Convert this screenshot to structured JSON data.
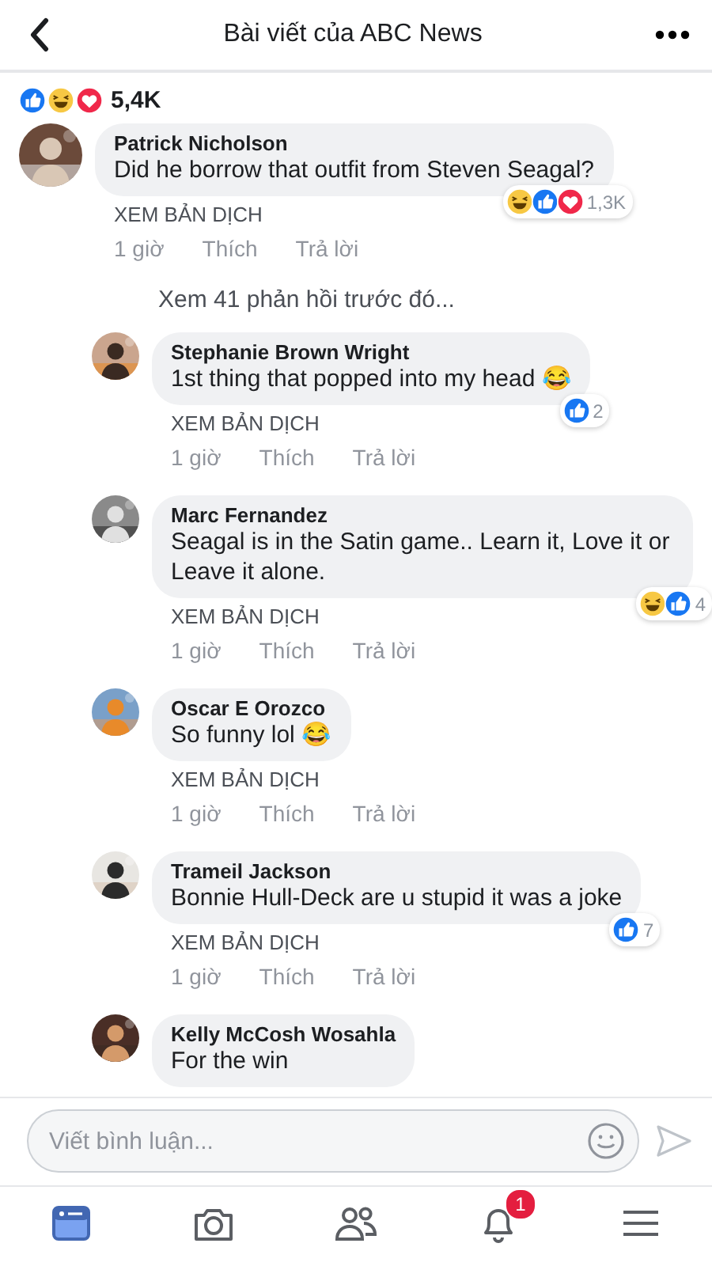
{
  "header": {
    "title": "Bài viết của ABC News"
  },
  "post_reactions": {
    "icons": [
      {
        "kind": "like"
      },
      {
        "kind": "haha"
      },
      {
        "kind": "love"
      }
    ],
    "count": "5,4K"
  },
  "comments": [
    {
      "author": "Patrick Nicholson",
      "text": "Did he borrow that outfit from Steven Seagal?",
      "translate": "XEM BẢN DỊCH",
      "time": "1 giờ",
      "like": "Thích",
      "reply": "Trả lời",
      "reactions": {
        "icons": [
          {
            "kind": "haha"
          },
          {
            "kind": "like"
          },
          {
            "kind": "love"
          }
        ],
        "count": "1,3K"
      },
      "previous_replies": "Xem 41 phản hồi trước đó...",
      "children": [
        {
          "author": "Stephanie Brown Wright",
          "text": "1st thing that popped into my head 😂",
          "translate": "XEM BẢN DỊCH",
          "time": "1 giờ",
          "like": "Thích",
          "reply": "Trả lời",
          "reactions": {
            "icons": [
              {
                "kind": "like"
              }
            ],
            "count": "2"
          }
        },
        {
          "author": "Marc Fernandez",
          "text": "Seagal is in the Satin game.. Learn it, Love it or Leave it alone.",
          "translate": "XEM BẢN DỊCH",
          "time": "1 giờ",
          "like": "Thích",
          "reply": "Trả lời",
          "reactions": {
            "icons": [
              {
                "kind": "haha"
              },
              {
                "kind": "like"
              }
            ],
            "count": "4"
          }
        },
        {
          "author": "Oscar E Orozco",
          "text": "So funny lol 😂",
          "translate": "XEM BẢN DỊCH",
          "time": "1 giờ",
          "like": "Thích",
          "reply": "Trả lời"
        },
        {
          "author": "Trameil Jackson",
          "text": "Bonnie Hull-Deck are u stupid it was a joke",
          "translate": "XEM BẢN DỊCH",
          "time": "1 giờ",
          "like": "Thích",
          "reply": "Trả lời",
          "reactions": {
            "icons": [
              {
                "kind": "like"
              }
            ],
            "count": "7"
          }
        },
        {
          "author": "Kelly McCosh Wosahla",
          "text": "For the win"
        }
      ]
    }
  ],
  "composer": {
    "placeholder": "Viết bình luận..."
  },
  "nav": [
    {
      "kind": "feed",
      "selected": true
    },
    {
      "kind": "camera",
      "selected": false
    },
    {
      "kind": "friends",
      "selected": false
    },
    {
      "kind": "notifications",
      "selected": false,
      "badge": "1"
    },
    {
      "kind": "menu",
      "selected": false
    }
  ]
}
